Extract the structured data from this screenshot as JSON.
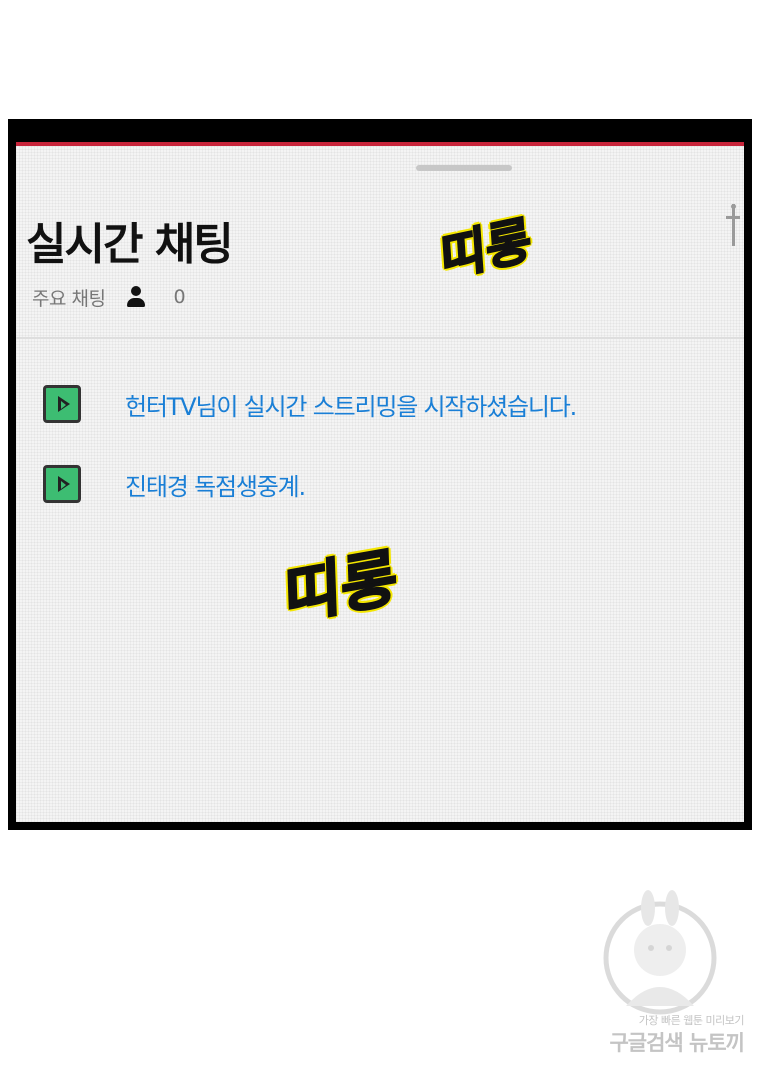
{
  "chat_panel": {
    "title": "실시간 채팅",
    "mode_label": "주요 채팅",
    "viewer_count": "0",
    "icons": {
      "viewer": "person-icon",
      "message": "play-icon",
      "handle": "drag-handle",
      "side": "side-handle"
    },
    "colors": {
      "accent_strip": "#c8243a",
      "message_text": "#1a7fd6",
      "play_icon": "#3dbd72"
    },
    "messages": [
      {
        "text": "헌터TV님이 실시간 스트리밍을 시작하셨습니다."
      },
      {
        "text": "진태경 독점생중계."
      }
    ]
  },
  "sound_effects": [
    {
      "text": "띠롱"
    },
    {
      "text": "띠롱"
    }
  ],
  "watermark": {
    "line1": "가장 빠른 웹툰 미리보기",
    "line2": "구글검색 뉴토끼"
  }
}
